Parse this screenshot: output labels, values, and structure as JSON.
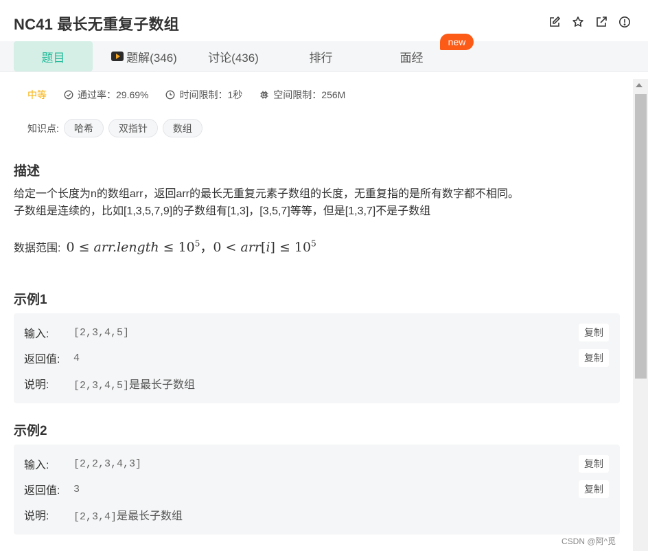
{
  "header": {
    "title": "NC41  最长无重复子数组",
    "icons": [
      "edit-icon",
      "star-icon",
      "external-link-icon",
      "info-icon"
    ]
  },
  "tabs": [
    {
      "label": "题目",
      "active": true
    },
    {
      "label": "题解(346)",
      "icon": "video-play-icon"
    },
    {
      "label": "讨论(436)"
    },
    {
      "label": "排行"
    },
    {
      "label": "面经"
    }
  ],
  "badge": {
    "label": "new",
    "color": "#fb5a17"
  },
  "meta": {
    "difficulty": "中等",
    "pass_rate": "通过率：29.69%",
    "time_limit": "时间限制：1秒",
    "space_limit": "空间限制：256M"
  },
  "knowledge": {
    "label": "知识点:",
    "tags": [
      "哈希",
      "双指针",
      "数组"
    ]
  },
  "description": {
    "heading": "描述",
    "line1": "给定一个长度为n的数组arr，返回arr的最长无重复元素子数组的长度，无重复指的是所有数字都不相同。",
    "line2": "子数组是连续的，比如[1,3,5,7,9]的子数组有[1,3]，[3,5,7]等等，但是[1,3,7]不是子数组",
    "range_label": "数据范围:",
    "range_math": {
      "a": "0 ≤ ",
      "b": "arr.length",
      "c": " ≤ 10",
      "d": "5",
      "e": "，0 < ",
      "f": "arr",
      "g": "[",
      "h": "i",
      "i": "]",
      "j": " ≤ 10",
      "k": "5"
    }
  },
  "examples": [
    {
      "heading": "示例1",
      "input_label": "输入:",
      "input": "[2,3,4,5]",
      "return_label": "返回值:",
      "return": "4",
      "explain_label": "说明:",
      "explain_code": "[2,3,4,5]",
      "explain_text": "是最长子数组",
      "copy_label": "复制"
    },
    {
      "heading": "示例2",
      "input_label": "输入:",
      "input": "[2,2,3,4,3]",
      "return_label": "返回值:",
      "return": "3",
      "explain_label": "说明:",
      "explain_code": "[2,3,4]",
      "explain_text": "是最长子数组",
      "copy_label": "复制"
    }
  ],
  "watermark": "CSDN @阿^觅",
  "colors": {
    "accent": "#25bb9b",
    "active_tab_bg": "#d5efe6",
    "difficulty": "#f8b006"
  }
}
